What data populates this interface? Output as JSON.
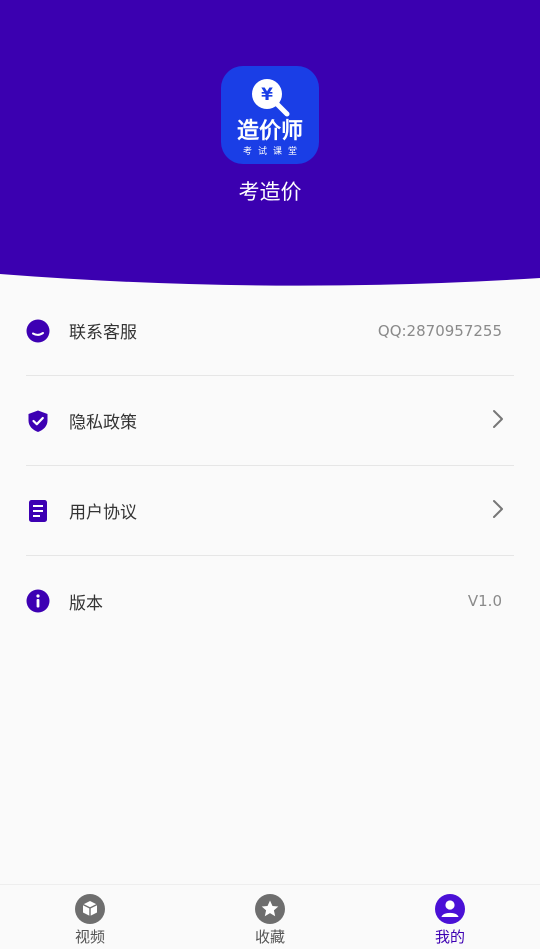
{
  "colors": {
    "header_bg": "#3b00b0",
    "accent": "#3d00b3",
    "logo_bg": "#1a3ee6"
  },
  "header": {
    "logo": {
      "currency_symbol": "¥",
      "name": "造价师",
      "subtitle": "考试课堂"
    },
    "app_name": "考造价"
  },
  "menu": {
    "items": [
      {
        "icon": "chat-bubble-icon",
        "label": "联系客服",
        "value": "QQ:2870957255"
      },
      {
        "icon": "shield-check-icon",
        "label": "隐私政策",
        "value": ""
      },
      {
        "icon": "document-icon",
        "label": "用户协议",
        "value": ""
      },
      {
        "icon": "info-icon",
        "label": "版本",
        "value": "V1.0"
      }
    ]
  },
  "tabbar": {
    "tabs": [
      {
        "icon": "cube-icon",
        "label": "视频",
        "active": false
      },
      {
        "icon": "star-icon",
        "label": "收藏",
        "active": false
      },
      {
        "icon": "user-icon",
        "label": "我的",
        "active": true
      }
    ]
  }
}
